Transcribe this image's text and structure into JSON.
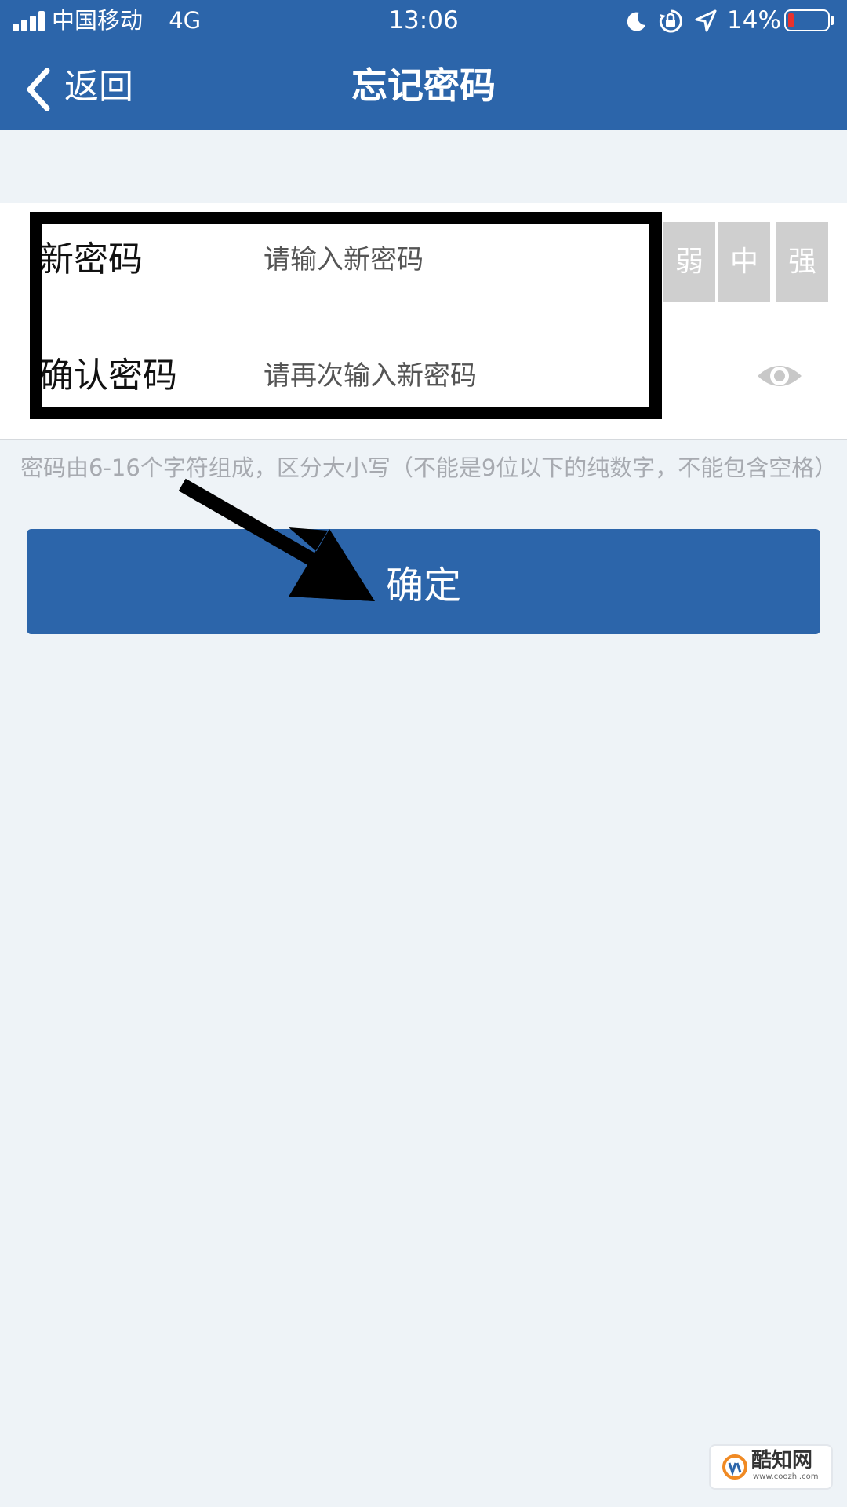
{
  "status_bar": {
    "carrier": "中国移动",
    "network": "4G",
    "time": "13:06",
    "battery": "14%",
    "battery_level": 0.14,
    "icons": [
      "signal-icon",
      "moon-icon",
      "rotation-lock-icon",
      "location-icon",
      "battery-icon"
    ]
  },
  "nav": {
    "back_label": "返回",
    "title": "忘记密码"
  },
  "form": {
    "new_password": {
      "label": "新密码",
      "placeholder": "请输入新密码"
    },
    "confirm_password": {
      "label": "确认密码",
      "placeholder": "请再次输入新密码"
    },
    "strength": {
      "weak": "弱",
      "medium": "中",
      "strong": "强"
    },
    "hint": "密码由6-16个字符组成，区分大小写（不能是9位以下的纯数字，不能包含空格）"
  },
  "confirm_button": "确定",
  "watermark": {
    "name": "酷知网",
    "url": "www.coozhi.com"
  },
  "colors": {
    "primary": "#2c65aa",
    "background": "#eef3f7",
    "strength_block": "#cfcfcf",
    "hint_text": "#a7aab0",
    "annotation": "#000000"
  }
}
